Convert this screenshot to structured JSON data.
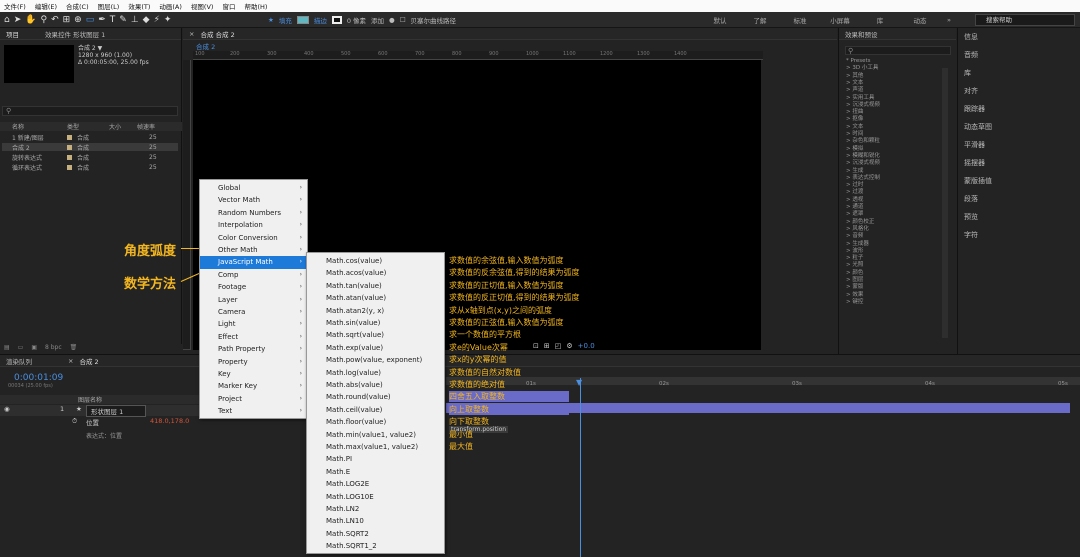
{
  "menubar": {
    "items": [
      "文件(F)",
      "编辑(E)",
      "合成(C)",
      "图层(L)",
      "效果(T)",
      "动画(A)",
      "视图(V)",
      "窗口",
      "帮助(H)"
    ]
  },
  "toolbar": {
    "fill_label": "填充",
    "stroke_label": "描边",
    "stroke_width": "0 像素",
    "add_label": "添加",
    "bezier_label": "贝塞尔曲线路径",
    "workspaces": [
      "默认",
      "了解",
      "标准",
      "小屏幕",
      "库",
      "动态"
    ],
    "search_help": "搜索帮助"
  },
  "project": {
    "tab": "项目",
    "effects_tab": "效果控件 形状图层 1",
    "comp_name": "合成 2 ▼",
    "comp_info1": "1280 x 960 (1.00)",
    "comp_info2": "Δ 0:00:05:00, 25.00 fps",
    "columns": [
      "名称",
      "类型",
      "大小",
      "帧速率"
    ],
    "rows": [
      {
        "name": "1 新建/图层",
        "type": "合成",
        "rate": "25"
      },
      {
        "name": "合成 2",
        "type": "合成",
        "rate": "25"
      },
      {
        "name": "旋转表达式",
        "type": "合成",
        "rate": "25"
      },
      {
        "name": "循环表达式",
        "type": "合成",
        "rate": "25"
      }
    ],
    "bpc": "8 bpc"
  },
  "composition": {
    "tab": "合成 合成 2",
    "subtab": "合成 2",
    "ruler": [
      "100",
      "200",
      "300",
      "400",
      "500",
      "600",
      "700",
      "800",
      "900",
      "1000",
      "1100",
      "1200",
      "1300",
      "1400"
    ],
    "zoom": "+0.0"
  },
  "effects_panel": {
    "title": "效果和预设",
    "items": [
      "* Presets",
      "> 3D 小工具",
      "> 其他",
      "> 文本",
      "> 声道",
      "> 实用工具",
      "> 沉浸式视频",
      "> 扭曲",
      "> 抠像",
      "> 文本",
      "> 时间",
      "> 杂色和颗粒",
      "> 模拟",
      "> 模糊和锐化",
      "> 沉浸式视频",
      "> 生成",
      "> 表达式控制",
      "> 过时",
      "> 过渡",
      "> 透视",
      "> 通道",
      "> 遮罩",
      "> 颜色校正",
      "> 风格化",
      "> 音频",
      "> 生成器",
      "> 波形",
      "> 粒子",
      "> 光照",
      "> 颜色",
      "> 图层",
      "> 蒙版",
      "> 效果",
      "> 键控"
    ]
  },
  "right_panel": {
    "items": [
      "信息",
      "音频",
      "库",
      "对齐",
      "跟踪器",
      "动态草图",
      "平滑器",
      "摇摆器",
      "蒙版插值",
      "段落",
      "预览",
      "字符"
    ]
  },
  "timeline": {
    "tab_render": "渲染队列",
    "tab_comp": "合成 2",
    "timecode": "0:00:01:09",
    "timecode_sub": "00034 (25.00 fps)",
    "col_layer": "图层名称",
    "layer_num": "1",
    "layer_name": "形状图层 1",
    "prop_name": "位置",
    "prop_value": "418.0,178.0",
    "expr_label": "表达式：位置",
    "ticks": [
      "01s",
      "02s",
      "03s",
      "04s",
      "05s"
    ],
    "expr_text": "transform.position"
  },
  "menu1": {
    "items": [
      "Global",
      "Vector Math",
      "Random Numbers",
      "Interpolation",
      "Color Conversion",
      "Other Math",
      "JavaScript Math",
      "Comp",
      "Footage",
      "Layer",
      "Camera",
      "Light",
      "Effect",
      "Path Property",
      "Property",
      "Key",
      "Marker Key",
      "Project",
      "Text"
    ],
    "selected": "JavaScript Math"
  },
  "menu2": {
    "items": [
      "Math.cos(value)",
      "Math.acos(value)",
      "Math.tan(value)",
      "Math.atan(value)",
      "Math.atan2(y, x)",
      "Math.sin(value)",
      "Math.sqrt(value)",
      "Math.exp(value)",
      "Math.pow(value, exponent)",
      "Math.log(value)",
      "Math.abs(value)",
      "Math.round(value)",
      "Math.ceil(value)",
      "Math.floor(value)",
      "Math.min(value1, value2)",
      "Math.max(value1, value2)",
      "Math.PI",
      "Math.E",
      "Math.LOG2E",
      "Math.LOG10E",
      "Math.LN2",
      "Math.LN10",
      "Math.SQRT2",
      "Math.SQRT1_2"
    ]
  },
  "annotations": {
    "lines": [
      "求数值的余弦值,输入数值为弧度",
      "求数值的反余弦值,得到的结果为弧度",
      "求数值的正切值,输入数值为弧度",
      "求数值的反正切值,得到的结果为弧度",
      "求从x轴到点(x,y)之间的弧度",
      "求数值的正弦值,输入数值为弧度",
      "求一个数值的平方根",
      "求e的Value次幂",
      "求x的y次幂的值",
      "求数值的自然对数值",
      "求数值的绝对值",
      "四舍五入取整数",
      "向上取整数",
      "向下取整数",
      "最小值",
      "最大值"
    ],
    "angle_label": "角度弧度",
    "math_label": "数学方法"
  },
  "colors": {
    "accent": "#1e7ad9",
    "annotation": "#f3b61f",
    "layer_bar": "#6a6ac8",
    "fill": "#5fb7c2"
  }
}
